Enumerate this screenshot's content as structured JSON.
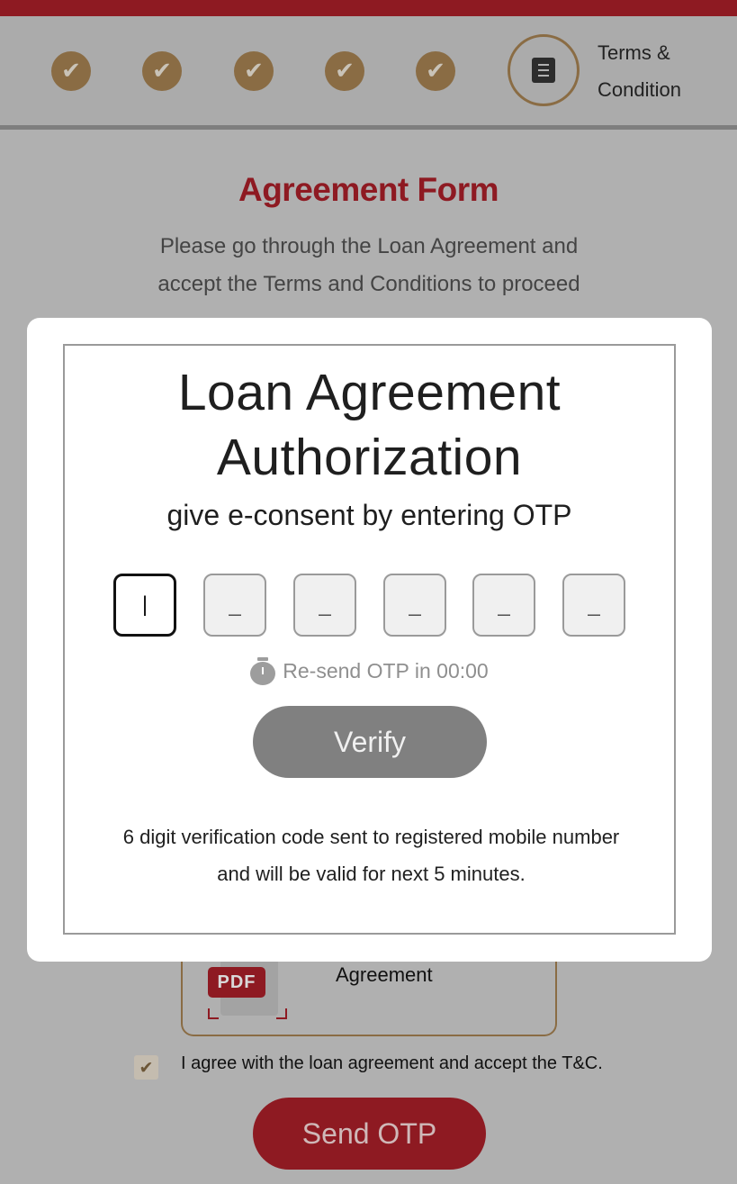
{
  "stepper": {
    "completed_mark": "✔",
    "current_step_label_line1": "Terms &",
    "current_step_label_line2": "Condition",
    "current_step_icon": "document-list-icon"
  },
  "form": {
    "title": "Agreement Form",
    "subtitle_line1": "Please go through the Loan Agreement and",
    "subtitle_line2": "accept the Terms and Conditions to proceed",
    "pdf_badge": "PDF",
    "pdf_label": "Agreement",
    "agree_text": "I agree with the loan agreement and accept the T&C.",
    "agree_checked": true,
    "send_otp_label": "Send OTP"
  },
  "modal": {
    "title_line1": "Loan Agreement",
    "title_line2": "Authorization",
    "subtitle": "give e-consent by entering OTP",
    "otp_digits": [
      "|",
      "_",
      "_",
      "_",
      "_",
      "_"
    ],
    "resend_text": "Re-send OTP  in 00:00",
    "resend_icon": "stopwatch-icon",
    "verify_label": "Verify",
    "note_line1": "6 digit verification code sent to registered mobile number",
    "note_line2": "and will be valid for next 5 minutes."
  },
  "colors": {
    "brand_red": "#8e1a22",
    "brand_gold": "#8a6c44",
    "overlay_gray": "#b0b0b0",
    "verify_gray": "#808080"
  }
}
